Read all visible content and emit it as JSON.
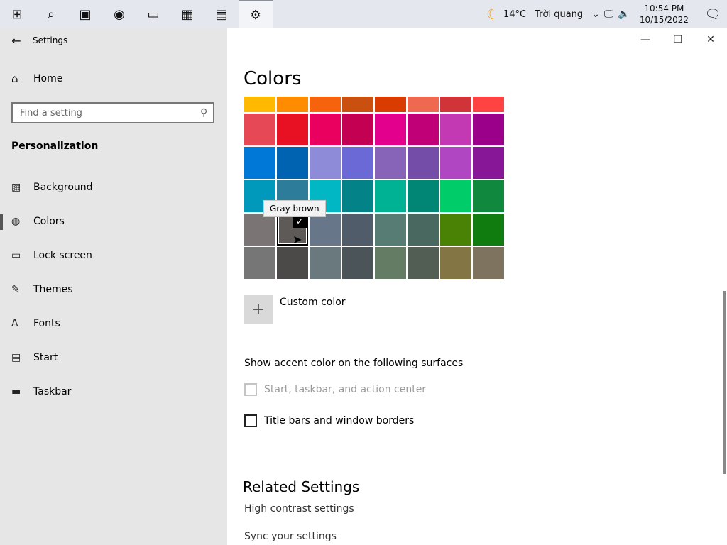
{
  "taskbar": {
    "icons": [
      {
        "name": "windows-start-icon",
        "glyph": "⊞"
      },
      {
        "name": "search-icon",
        "glyph": "⌕"
      },
      {
        "name": "task-view-icon",
        "glyph": "▣"
      },
      {
        "name": "edge-browser-icon",
        "glyph": "◉"
      },
      {
        "name": "file-explorer-icon",
        "glyph": "▭"
      },
      {
        "name": "microsoft-store-icon",
        "glyph": "▦"
      },
      {
        "name": "app-icon",
        "glyph": "▤"
      },
      {
        "name": "settings-gear-icon",
        "glyph": "⚙"
      }
    ],
    "weather_temp": "14°C",
    "weather_text": "Trời quang",
    "time": "10:54 PM",
    "date": "10/15/2022"
  },
  "window": {
    "app_title": "Settings"
  },
  "sidebar": {
    "home_label": "Home",
    "search_placeholder": "Find a setting",
    "section_title": "Personalization",
    "items": [
      {
        "label": "Background",
        "icon": "image-icon",
        "glyph": "▨"
      },
      {
        "label": "Colors",
        "icon": "palette-icon",
        "glyph": "◍",
        "selected": true
      },
      {
        "label": "Lock screen",
        "icon": "lock-screen-icon",
        "glyph": "▭"
      },
      {
        "label": "Themes",
        "icon": "themes-icon",
        "glyph": "✎"
      },
      {
        "label": "Fonts",
        "icon": "fonts-icon",
        "glyph": "A"
      },
      {
        "label": "Start",
        "icon": "start-icon",
        "glyph": "▤"
      },
      {
        "label": "Taskbar",
        "icon": "taskbar-icon",
        "glyph": "▬"
      }
    ]
  },
  "main": {
    "title": "Colors",
    "tooltip": "Gray brown",
    "custom_color_label": "Custom color",
    "surfaces_title": "Show accent color on the following surfaces",
    "checkbox_start": "Start, taskbar, and action center",
    "checkbox_titlebars": "Title bars and window borders",
    "related_title": "Related Settings",
    "link_high_contrast": "High contrast settings",
    "link_sync": "Sync your settings"
  },
  "swatch_rows": [
    {
      "height": 22,
      "colors": [
        "#FFB900",
        "#FF8C00",
        "#F7630C",
        "#CA5010",
        "#DA3B01",
        "#EF6950",
        "#D13438",
        "#FF4343"
      ]
    },
    {
      "height": 45,
      "colors": [
        "#E74856",
        "#E81123",
        "#EA005E",
        "#C30052",
        "#E3008C",
        "#BF0077",
        "#C239B3",
        "#9A0089"
      ]
    },
    {
      "height": 45,
      "colors": [
        "#0078D7",
        "#0063B1",
        "#8E8CD8",
        "#6B69D6",
        "#8764B8",
        "#744DA9",
        "#B146C2",
        "#881798"
      ]
    },
    {
      "height": 45,
      "colors": [
        "#0099BC",
        "#2D7D9A",
        "#00B7C3",
        "#038387",
        "#00B294",
        "#018574",
        "#00CC6A",
        "#10893E"
      ]
    },
    {
      "height": 45,
      "colors": [
        "#7A7574",
        "#5D5A58",
        "#68768A",
        "#515C6B",
        "#567C73",
        "#486860",
        "#498205",
        "#107C10"
      ]
    },
    {
      "height": 45,
      "colors": [
        "#767676",
        "#4C4A48",
        "#69797E",
        "#4A5459",
        "#647C64",
        "#525E54",
        "#847545",
        "#7E735F"
      ]
    }
  ],
  "selected_swatch": {
    "row": 4,
    "col": 1
  }
}
